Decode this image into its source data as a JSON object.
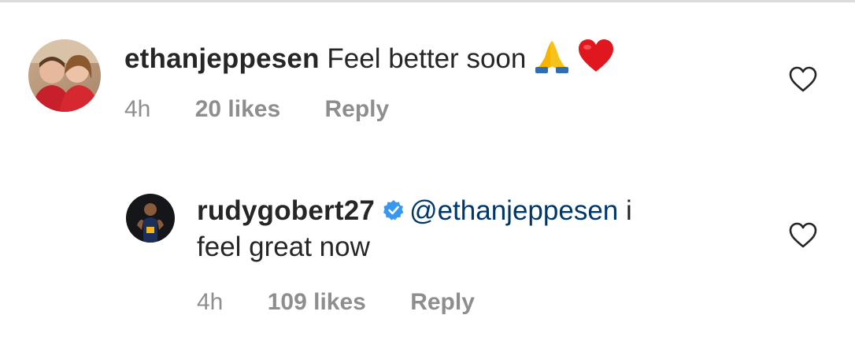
{
  "comments": [
    {
      "username": "ethanjeppesen",
      "text": "Feel better soon",
      "emojis": [
        "folded-hands",
        "red-heart"
      ],
      "time": "4h",
      "likes": "20 likes",
      "reply": "Reply"
    },
    {
      "username": "rudygobert27",
      "verified": true,
      "mention": "@ethanjeppesen",
      "text_line1_suffix": "i",
      "text_line2": "feel great now",
      "time": "4h",
      "likes": "109 likes",
      "reply": "Reply"
    }
  ],
  "colors": {
    "text": "#262626",
    "meta": "#8e8e8e",
    "mention": "#00376b",
    "verified": "#3897f0",
    "heart_outline": "#262626",
    "divider": "#dbdbdb"
  },
  "icons": {
    "like": "heart-outline-icon",
    "verified": "verified-badge-icon"
  }
}
